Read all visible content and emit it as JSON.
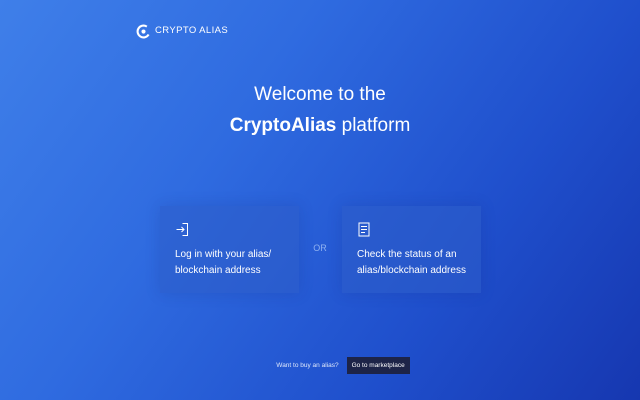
{
  "brand": {
    "logo_text": "CRYPTO ALIAS",
    "logo_icon": "crypto-alias-logo-icon"
  },
  "hero": {
    "line1": "Welcome to the",
    "brand_name": "CryptoAlias",
    "line2_suffix": " platform"
  },
  "cards": {
    "login": {
      "icon": "login-icon",
      "line1": "Log in with your alias/",
      "line2": "blockchain address"
    },
    "or_label": "OR",
    "status": {
      "icon": "checklist-icon",
      "line1": "Check the status of an",
      "line2": "alias/blockchain address"
    }
  },
  "footer": {
    "prompt": "Want to buy an alias?",
    "marketplace_label": "Go to marketplace"
  },
  "colors": {
    "background_start": "#3f7fe9",
    "background_end": "#1637b0",
    "card_bg": "#2d5cc8",
    "button_bg": "#1d2448",
    "or_text": "#8fb1f0"
  }
}
